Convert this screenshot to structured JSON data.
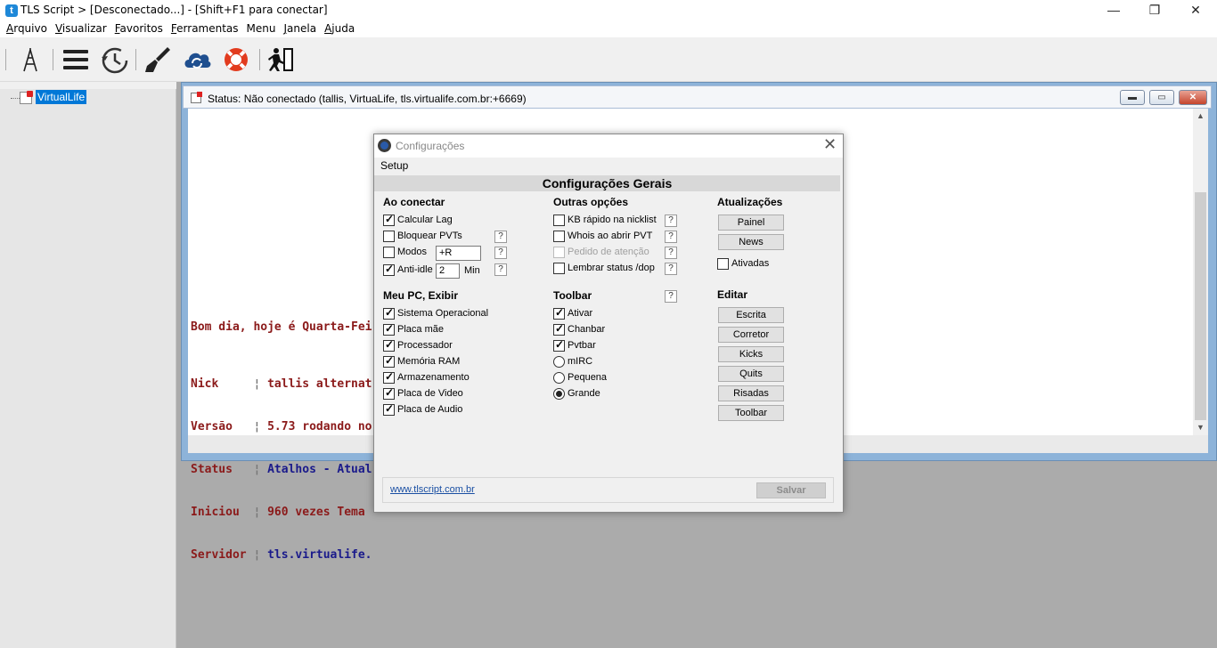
{
  "window": {
    "icon_letter": "t",
    "title": "TLS Script > [Desconectado...] - [Shift+F1 para conectar]",
    "minimize": "—",
    "restore": "❐",
    "close": "✕"
  },
  "menubar": [
    {
      "first": "A",
      "rest": "rquivo"
    },
    {
      "first": "V",
      "rest": "isualizar"
    },
    {
      "first": "F",
      "rest": "avoritos"
    },
    {
      "first": "F",
      "rest": "erramentas"
    },
    {
      "first": "",
      "rest": "Menu"
    },
    {
      "first": "J",
      "rest": "anela"
    },
    {
      "first": "A",
      "rest": "juda"
    }
  ],
  "toolbar_icons": [
    "antenna-icon",
    "menu-icon",
    "clock-icon",
    "brush-icon",
    "cloud-sync-icon",
    "lifebuoy-icon",
    "exit-icon"
  ],
  "tree": {
    "node_label": "VirtualLife"
  },
  "status_window": {
    "title": "Status: Não conectado (tallis, VirtuaLife, tls.virtualife.com.br:+6669)",
    "greeting": "Bom dia, hoje é Quarta-Fei",
    "rows": [
      {
        "key": "Nick    ",
        "sep": " ¦ ",
        "val": "tallis alternat",
        "color": "c-red"
      },
      {
        "key": "Versão  ",
        "sep": " ¦ ",
        "val": "5.73 rodando no",
        "color": "c-red"
      },
      {
        "key": "Status  ",
        "sep": " ¦ ",
        "val": "Atalhos - Atual",
        "color": "c-navy"
      },
      {
        "key": "Iniciou ",
        "sep": " ¦ ",
        "val": "960 vezes Tema ",
        "color": "c-red"
      },
      {
        "key": "Servidor",
        "sep": " ¦ ",
        "val": "tls.virtualife.",
        "color": "c-navy"
      }
    ]
  },
  "dialog": {
    "title": "Configurações",
    "menu": "Setup",
    "header": "Configurações Gerais",
    "sections": {
      "ao_conectar": "Ao conectar",
      "outras": "Outras opções",
      "atualizacoes": "Atualizações",
      "meu_pc": "Meu PC, Exibir",
      "toolbar": "Toolbar",
      "editar": "Editar"
    },
    "ao_conectar": {
      "calcular_lag": "Calcular Lag",
      "bloquear_pvts": "Bloquear PVTs",
      "modos": "Modos",
      "modos_value": "+R",
      "anti_idle": "Anti-idle",
      "anti_idle_value": "2",
      "min": "Min"
    },
    "outras": {
      "kb_rapido": "KB rápido na nicklist",
      "whois": "Whois ao abrir PVT",
      "pedido": "Pedido de atenção",
      "lembrar": "Lembrar status /dop"
    },
    "atualizacoes": {
      "painel": "Painel",
      "news": "News",
      "ativadas": "Ativadas"
    },
    "meu_pc": {
      "so": "Sistema Operacional",
      "placa_mae": "Placa mãe",
      "processador": "Processador",
      "memoria": "Memória RAM",
      "armazenamento": "Armazenamento",
      "video": "Placa de Video",
      "audio": "Placa de Audio"
    },
    "toolbar_opts": {
      "ativar": "Ativar",
      "chanbar": "Chanbar",
      "pvtbar": "Pvtbar",
      "mirc": "mIRC",
      "pequena": "Pequena",
      "grande": "Grande"
    },
    "editar": {
      "escrita": "Escrita",
      "corretor": "Corretor",
      "kicks": "Kicks",
      "quits": "Quits",
      "risadas": "Risadas",
      "toolbar": "Toolbar"
    },
    "help": "?",
    "close": "✕",
    "footer_link": "www.tlscript.com.br",
    "save": "Salvar"
  }
}
